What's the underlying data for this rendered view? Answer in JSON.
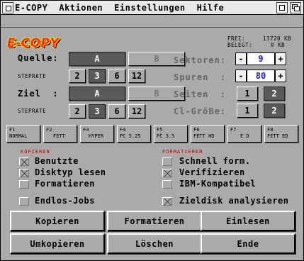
{
  "menu": [
    "E-COPY",
    "Aktionen",
    "Einstellungen",
    "Hilfe"
  ],
  "logo": "E-COPY",
  "status": {
    "frei_label": "FREI:",
    "frei_value": "13720 KB",
    "belegt_label": "BELEGT:",
    "belegt_value": "0 KB"
  },
  "quelle": {
    "label": "Quelle:",
    "drive_a": "A",
    "drive_b": "B",
    "steprate_label": "STEPRATE",
    "steprates": [
      "2",
      "3",
      "6",
      "12"
    ]
  },
  "ziel": {
    "label": "Ziel  :",
    "drive_a": "A",
    "drive_b": "B",
    "steprate_label": "STEPRATE",
    "steprates": [
      "2",
      "3",
      "6",
      "12"
    ]
  },
  "sektoren": {
    "label": "Sektoren:",
    "minus": "-",
    "value": "9",
    "plus": "+"
  },
  "spuren": {
    "label": "Spuren  :",
    "minus": "-",
    "value": "80",
    "plus": "+"
  },
  "seiten": {
    "label": "Seiten  :",
    "opt1": "1",
    "opt2": "2"
  },
  "clgroesse": {
    "label": "Cl-GröBe:",
    "opt1": "1",
    "opt2": "2"
  },
  "fkeys": [
    {
      "key": "F1",
      "label": "NORMAL"
    },
    {
      "key": "F2",
      "label": "FETT"
    },
    {
      "key": "F3",
      "label": "HYPER"
    },
    {
      "key": "F4",
      "label": "PC 5.25"
    },
    {
      "key": "F5",
      "label": "PC 3.5"
    },
    {
      "key": "F6",
      "label": "FETT HD"
    },
    {
      "key": "F7",
      "label": "E D"
    },
    {
      "key": "F8",
      "label": "FETT ED"
    }
  ],
  "sections": {
    "kopieren": "KOPIEREN",
    "formatieren": "FORMATIEREN"
  },
  "options_left": [
    {
      "label": "Benutzte",
      "checked": true
    },
    {
      "label": "Disktyp lesen",
      "checked": true
    },
    {
      "label": "Formatieren",
      "checked": false
    },
    {
      "label": "Endlos-Jobs",
      "checked": false
    }
  ],
  "options_right": [
    {
      "label": "Schnell form.",
      "checked": false
    },
    {
      "label": "Verifizieren",
      "checked": true
    },
    {
      "label": "IBM-Kompatibel",
      "checked": false
    },
    {
      "label": "Zieldisk analysieren",
      "checked": true
    }
  ],
  "buttons": [
    "Kopieren",
    "Formatieren",
    "Einlesen",
    "Umkopieren",
    "Löschen",
    "Ende"
  ]
}
